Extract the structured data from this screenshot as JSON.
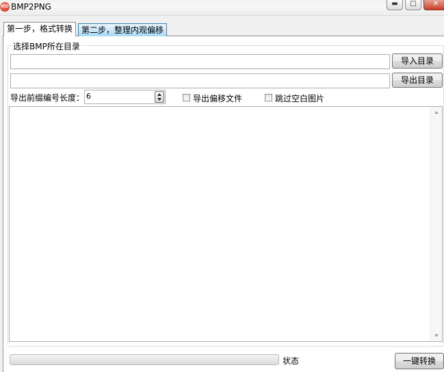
{
  "window": {
    "title": "BMP2PNG",
    "icon": "app-icon",
    "controls": {
      "minimize": "minimize-icon",
      "maximize": "maximize-icon",
      "close": "close-icon"
    }
  },
  "tabs": [
    {
      "label": "第一步，格式转换",
      "active": true
    },
    {
      "label": "第二步，整理内观偏移",
      "active": false
    }
  ],
  "group": {
    "label": "选择BMP所在目录"
  },
  "import": {
    "value": "",
    "button_label": "导入目录"
  },
  "export": {
    "value": "",
    "button_label": "导出目录"
  },
  "prefix": {
    "label": "导出前缀编号长度：",
    "value": "6"
  },
  "options": {
    "export_offset": {
      "label": "导出偏移文件",
      "checked": false
    },
    "skip_blank": {
      "label": "跳过空白图片",
      "checked": false
    }
  },
  "log": {
    "text": ""
  },
  "status": {
    "progress": 0,
    "label": "状态"
  },
  "action": {
    "button_label": "一键转换"
  },
  "colors": {
    "progress_fill": "#06b025",
    "tab_inactive": "#a7d9f5"
  }
}
